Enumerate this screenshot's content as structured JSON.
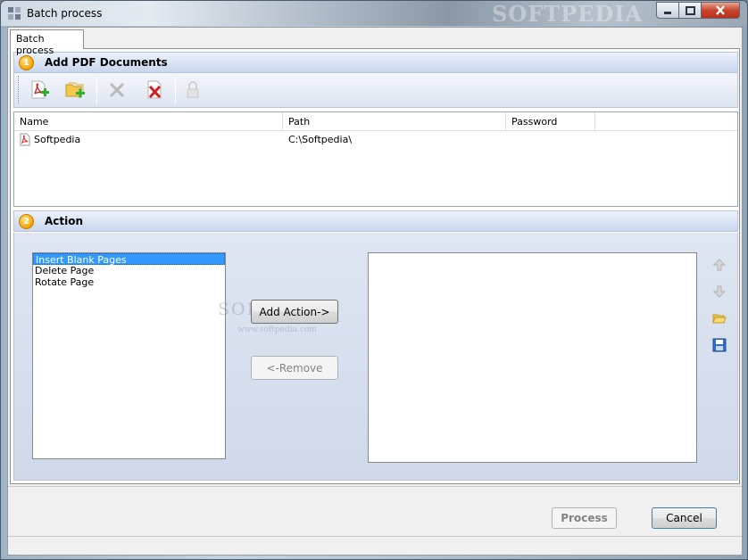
{
  "window": {
    "title": "Batch process",
    "watermark": "SOFTPEDIA"
  },
  "tabs": [
    {
      "label": "Batch process",
      "active": true
    }
  ],
  "add_section": {
    "number": "1",
    "title": "Add PDF Documents",
    "toolbar": [
      {
        "name": "add-pdf",
        "icon": "add-pdf-icon",
        "enabled": true
      },
      {
        "name": "add-folder",
        "icon": "add-folder-icon",
        "enabled": true
      },
      {
        "name": "remove",
        "icon": "delete-x-icon",
        "enabled": false
      },
      {
        "name": "remove-all",
        "icon": "remove-all-icon",
        "enabled": true
      },
      {
        "name": "lock",
        "icon": "lock-icon",
        "enabled": false
      }
    ]
  },
  "file_list": {
    "columns": [
      "Name",
      "Path",
      "Password"
    ],
    "rows": [
      {
        "name": "Softpedia",
        "path": "C:\\Softpedia\\",
        "password": ""
      }
    ]
  },
  "action_section": {
    "number": "2",
    "title": "Action",
    "available_actions": [
      "Insert Blank Pages",
      "Delete Page",
      "Rotate Page"
    ],
    "selected_action_index": 0,
    "add_button": "Add Action->",
    "remove_button": "<-Remove",
    "watermark_text": "SOFTPEDIA",
    "watermark_url": "www.softpedia.com"
  },
  "footer": {
    "process_button": "Process",
    "cancel_button": "Cancel"
  },
  "colors": {
    "section_header": "#d6e1f3",
    "selection": "#3399ff",
    "badge": "#f4a300"
  }
}
